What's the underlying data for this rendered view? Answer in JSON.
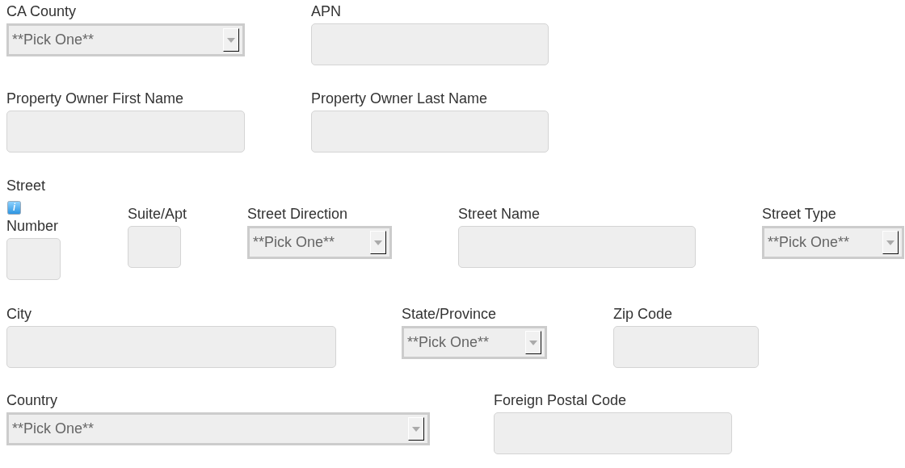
{
  "rows": [
    {
      "fields": [
        {
          "kind": "select",
          "label": "CA County",
          "value": "**Pick One**"
        },
        {
          "kind": "text",
          "label": "APN"
        }
      ]
    },
    {
      "fields": [
        {
          "kind": "text",
          "label": "Property Owner First Name"
        },
        {
          "kind": "text",
          "label": "Property Owner Last Name"
        }
      ]
    },
    {
      "fields": [
        {
          "kind": "street_number",
          "label": "Street",
          "sublabel": "Number"
        },
        {
          "kind": "text",
          "label": "Suite/Apt"
        },
        {
          "kind": "select",
          "label": "Street Direction",
          "value": "**Pick One**"
        },
        {
          "kind": "text",
          "label": "Street Name"
        },
        {
          "kind": "select",
          "label": "Street Type",
          "value": "**Pick One**"
        }
      ]
    },
    {
      "fields": [
        {
          "kind": "text",
          "label": "City"
        },
        {
          "kind": "select",
          "label": "State/Province",
          "value": "**Pick One**"
        },
        {
          "kind": "text",
          "label": "Zip Code"
        }
      ]
    },
    {
      "fields": [
        {
          "kind": "select",
          "label": "Country",
          "value": "**Pick One**"
        },
        {
          "kind": "text",
          "label": "Foreign Postal Code"
        }
      ]
    }
  ]
}
